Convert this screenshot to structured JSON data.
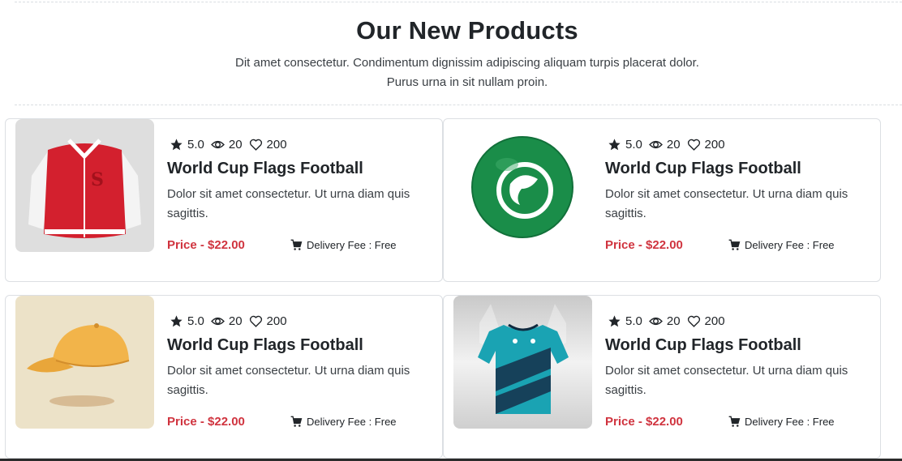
{
  "section": {
    "title": "Our New Products",
    "subtitle": "Dit amet consectetur. Condimentum dignissim adipiscing aliquam turpis placerat dolor. Purus urna in sit nullam proin."
  },
  "products": [
    {
      "image": "red-varsity-jacket",
      "rating": "5.0",
      "views": "20",
      "likes": "200",
      "name": "World Cup Flags Football",
      "description": "Dolor sit amet consectetur. Ut urna diam quis sagittis.",
      "price": "Price - $22.00",
      "delivery": "Delivery Fee : Free"
    },
    {
      "image": "green-football",
      "rating": "5.0",
      "views": "20",
      "likes": "200",
      "name": "World Cup Flags Football",
      "description": "Dolor sit amet consectetur. Ut urna diam quis sagittis.",
      "price": "Price - $22.00",
      "delivery": "Delivery Fee : Free"
    },
    {
      "image": "yellow-cap",
      "rating": "5.0",
      "views": "20",
      "likes": "200",
      "name": "World Cup Flags Football",
      "description": "Dolor sit amet consectetur. Ut urna diam quis sagittis.",
      "price": "Price - $22.00",
      "delivery": "Delivery Fee : Free"
    },
    {
      "image": "teal-football-jersey",
      "rating": "5.0",
      "views": "20",
      "likes": "200",
      "name": "World Cup Flags Football",
      "description": "Dolor sit amet consectetur. Ut urna diam quis sagittis.",
      "price": "Price - $22.00",
      "delivery": "Delivery Fee : Free"
    }
  ],
  "colors": {
    "price": "#d0343f",
    "text": "#212529",
    "border": "#dcdfe3"
  }
}
